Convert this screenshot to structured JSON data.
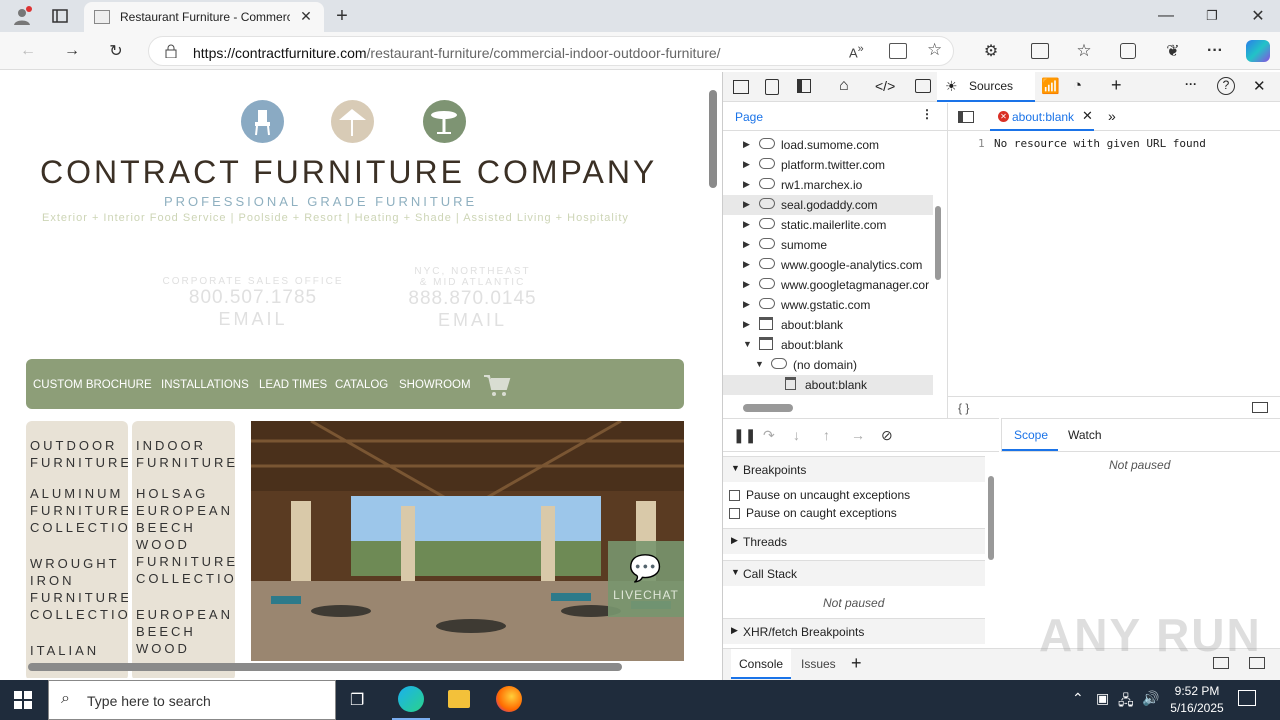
{
  "browser": {
    "tab_title": "Restaurant Furniture - Commerci",
    "url_host": "https://contractfurniture.com",
    "url_path": "/restaurant-furniture/commercial-indoor-outdoor-furniture/"
  },
  "site": {
    "brand": "CONTRACT FURNITURE COMPANY",
    "tagline": "PROFESSIONAL GRADE FURNITURE",
    "subline": "Exterior + Interior Food Service | Poolside + Resort | Heating + Shade | Assisted Living + Hospitality",
    "contacts": [
      {
        "label": "CORPORATE SALES OFFICE",
        "number": "800.507.1785",
        "email": "EMAIL"
      },
      {
        "label": "NYC, NORTHEAST\n& MID ATLANTIC",
        "number": "888.870.0145",
        "email": "EMAIL"
      }
    ],
    "nav": [
      "CUSTOM BROCHURE",
      "INSTALLATIONS",
      "LEAD TIMES",
      "CATALOG",
      "SHOWROOM"
    ],
    "outdoor_col": [
      "OUTDOOR\nFURNITURE",
      "ALUMINUM\nFURNITURE\nCOLLECTIONS",
      "WROUGHT\nIRON\nFURNITURE\nCOLLECTIONS",
      "ITALIAN"
    ],
    "indoor_col": [
      "INDOOR\nFURNITURE",
      "HOLSAG\nEUROPEAN\nBEECH\nWOOD\nFURNITURE\nCOLLECTION",
      "EUROPEAN\nBEECH\nWOOD"
    ],
    "livechat": "LIVECHAT"
  },
  "devtools": {
    "sources_tab": "Sources",
    "page_tab": "Page",
    "open_file": "about:blank",
    "editor_line_no": "1",
    "editor_text": "No resource with given URL found",
    "tree": [
      "load.sumome.com",
      "platform.twitter.com",
      "rw1.marchex.io",
      "seal.godaddy.com",
      "static.mailerlite.com",
      "sumome",
      "www.google-analytics.com",
      "www.googletagmanager.cor",
      "www.gstatic.com",
      "about:blank",
      "about:blank",
      "(no domain)",
      "about:blank"
    ],
    "sections": {
      "breakpoints": "Breakpoints",
      "pause_uncaught": "Pause on uncaught exceptions",
      "pause_caught": "Pause on caught exceptions",
      "threads": "Threads",
      "call_stack": "Call Stack",
      "not_paused": "Not paused",
      "xhr": "XHR/fetch Breakpoints"
    },
    "scope_tab": "Scope",
    "watch_tab": "Watch",
    "scope_not_paused": "Not paused",
    "console_tab": "Console",
    "issues_tab": "Issues",
    "braces": "{ }"
  },
  "taskbar": {
    "search_placeholder": "Type here to search",
    "time": "9:52 PM",
    "date": "5/16/2025"
  },
  "watermark": "ANY RUN"
}
